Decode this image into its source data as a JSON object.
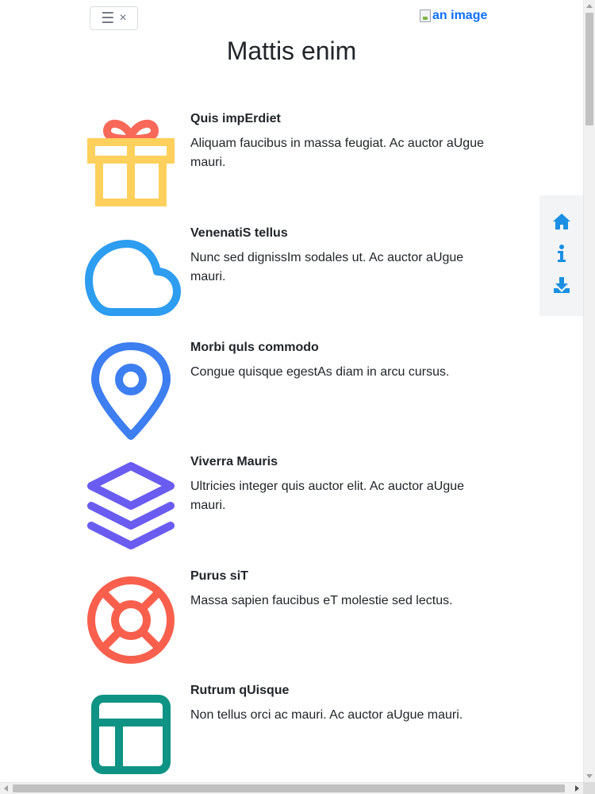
{
  "header": {
    "toggle_menu_icon": "☰",
    "toggle_close_icon": "×",
    "brand_image_alt": "an image"
  },
  "page_title": "Mattis enim",
  "features": [
    {
      "icon": "gift-icon",
      "title": "Quis impErdiet",
      "text": "Aliquam faucibus in massa feugiat. Ac auctor aUgue mauri."
    },
    {
      "icon": "cloud-icon",
      "title": "VenenatiS tellus",
      "text": "Nunc sed dignissIm sodales ut. Ac auctor aUgue mauri."
    },
    {
      "icon": "map-pin-icon",
      "title": "Morbi quls commodo",
      "text": "Congue quisque egestAs diam in arcu cursus."
    },
    {
      "icon": "layers-icon",
      "title": "Viverra Mauris",
      "text": "Ultricies integer quis auctor elit. Ac auctor aUgue mauri."
    },
    {
      "icon": "lifebuoy-icon",
      "title": "Purus siT",
      "text": "Massa sapien faucibus eT molestie sed lectus."
    },
    {
      "icon": "layout-icon",
      "title": "Rutrum qUisque",
      "text": "Non tellus orci ac mauri. Ac auctor aUgue mauri."
    }
  ],
  "side_nav": {
    "items": [
      {
        "icon": "home-icon"
      },
      {
        "icon": "info-icon"
      },
      {
        "icon": "download-icon"
      }
    ],
    "color": "#1a8fe3"
  },
  "colors": {
    "gift_ribbon": "#f8695a",
    "gift_box": "#ffd05b",
    "cloud": "#2d9df0",
    "map_pin": "#3d7ef0",
    "layers": "#6a5cf0",
    "lifebuoy": "#f8604d",
    "layout": "#0e9384"
  }
}
